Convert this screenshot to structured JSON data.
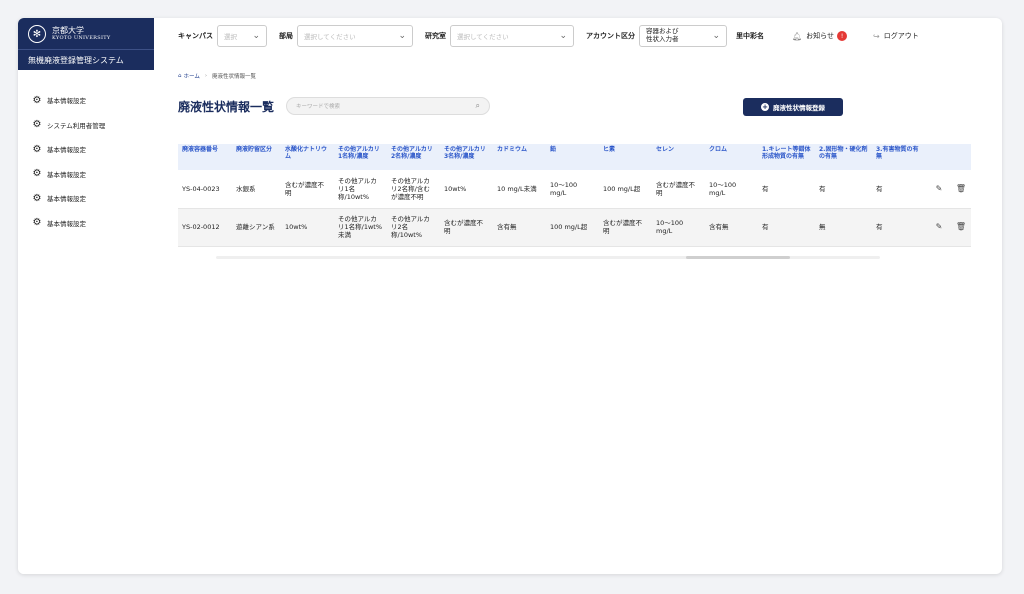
{
  "sidebar": {
    "logo_jp": "京都大学",
    "logo_en": "KYOTO UNIVERSITY",
    "system_name": "無機廃液登録管理システム",
    "items": [
      {
        "label": "基本情報設定"
      },
      {
        "label": "システム利用者管理"
      },
      {
        "label": "基本情報設定"
      },
      {
        "label": "基本情報設定"
      },
      {
        "label": "基本情報設定"
      },
      {
        "label": "基本情報設定"
      }
    ]
  },
  "header": {
    "campus_label": "キャンパス",
    "campus_placeholder": "選択",
    "dept_label": "部局",
    "dept_placeholder": "選択してください",
    "lab_label": "研究室",
    "lab_placeholder": "選択してください",
    "account_label": "アカウント区分",
    "account_value_line1": "容器および",
    "account_value_line2": "性状入力者",
    "user_name": "里中彩名",
    "notice_label": "お知らせ",
    "notice_count": "!",
    "logout_label": "ログアウト"
  },
  "breadcrumb": {
    "home": "ホーム",
    "separator": "›",
    "current": "廃液性状情報一覧"
  },
  "page": {
    "title": "廃液性状情報一覧",
    "search_placeholder": "キーワードで検索",
    "add_button": "廃液性状情報登録"
  },
  "table": {
    "headers": [
      "廃液容器番号",
      "廃液貯留区分",
      "水酸化ナトリウム",
      "その他アルカリ1名称/濃度",
      "その他アルカリ2名称/濃度",
      "その他アルカリ3名称/濃度",
      "カドミウム",
      "鉛",
      "ヒ素",
      "セレン",
      "クロム",
      "1.キレート等錯体形成物質の有無",
      "2.固形物・硬化剤の有無",
      "3.有害物質の有無"
    ],
    "rows": [
      [
        "YS-04-0023",
        "水銀系",
        "含むが濃度不明",
        "その他アルカリ1名称/10wt%",
        "その他アルカリ2名称/含むが濃度不明",
        "10wt%",
        "10 mg/L未満",
        "10〜100 mg/L",
        "100 mg/L超",
        "含むが濃度不明",
        "10〜100 mg/L",
        "有",
        "有",
        "有"
      ],
      [
        "YS-02-0012",
        "遊離シアン系",
        "10wt%",
        "その他アルカリ1名称/1wt%未満",
        "その他アルカリ2名称/10wt%",
        "含むが濃度不明",
        "含有無",
        "100 mg/L超",
        "含むが濃度不明",
        "10〜100 mg/L",
        "含有無",
        "有",
        "無",
        "有"
      ]
    ]
  },
  "scrollbar": {
    "position": 0.84
  }
}
